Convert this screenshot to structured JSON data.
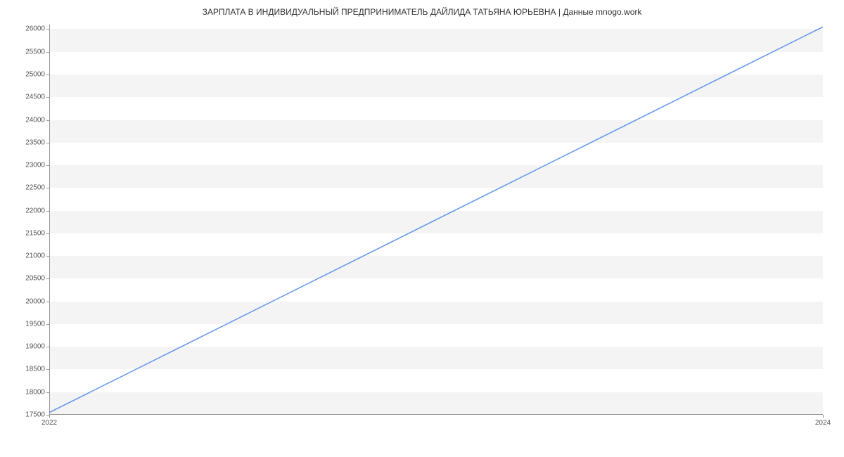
{
  "chart_data": {
    "type": "line",
    "title": "ЗАРПЛАТА В ИНДИВИДУАЛЬНЫЙ ПРЕДПРИНИМАТЕЛЬ ДАЙЛИДА ТАТЬЯНА ЮРЬЕВНА | Данные mnogo.work",
    "xlabel": "",
    "ylabel": "",
    "x": [
      2022,
      2024
    ],
    "values": [
      17550,
      26050
    ],
    "x_ticks": [
      2022,
      2024
    ],
    "y_ticks": [
      17500,
      18000,
      18500,
      19000,
      19500,
      20000,
      20500,
      21000,
      21500,
      22000,
      22500,
      23000,
      23500,
      24000,
      24500,
      25000,
      25500,
      26000
    ],
    "ylim": [
      17500,
      26100
    ],
    "xlim": [
      2022,
      2024
    ],
    "line_color": "#6495ED",
    "band_color": "#f4f4f4"
  }
}
